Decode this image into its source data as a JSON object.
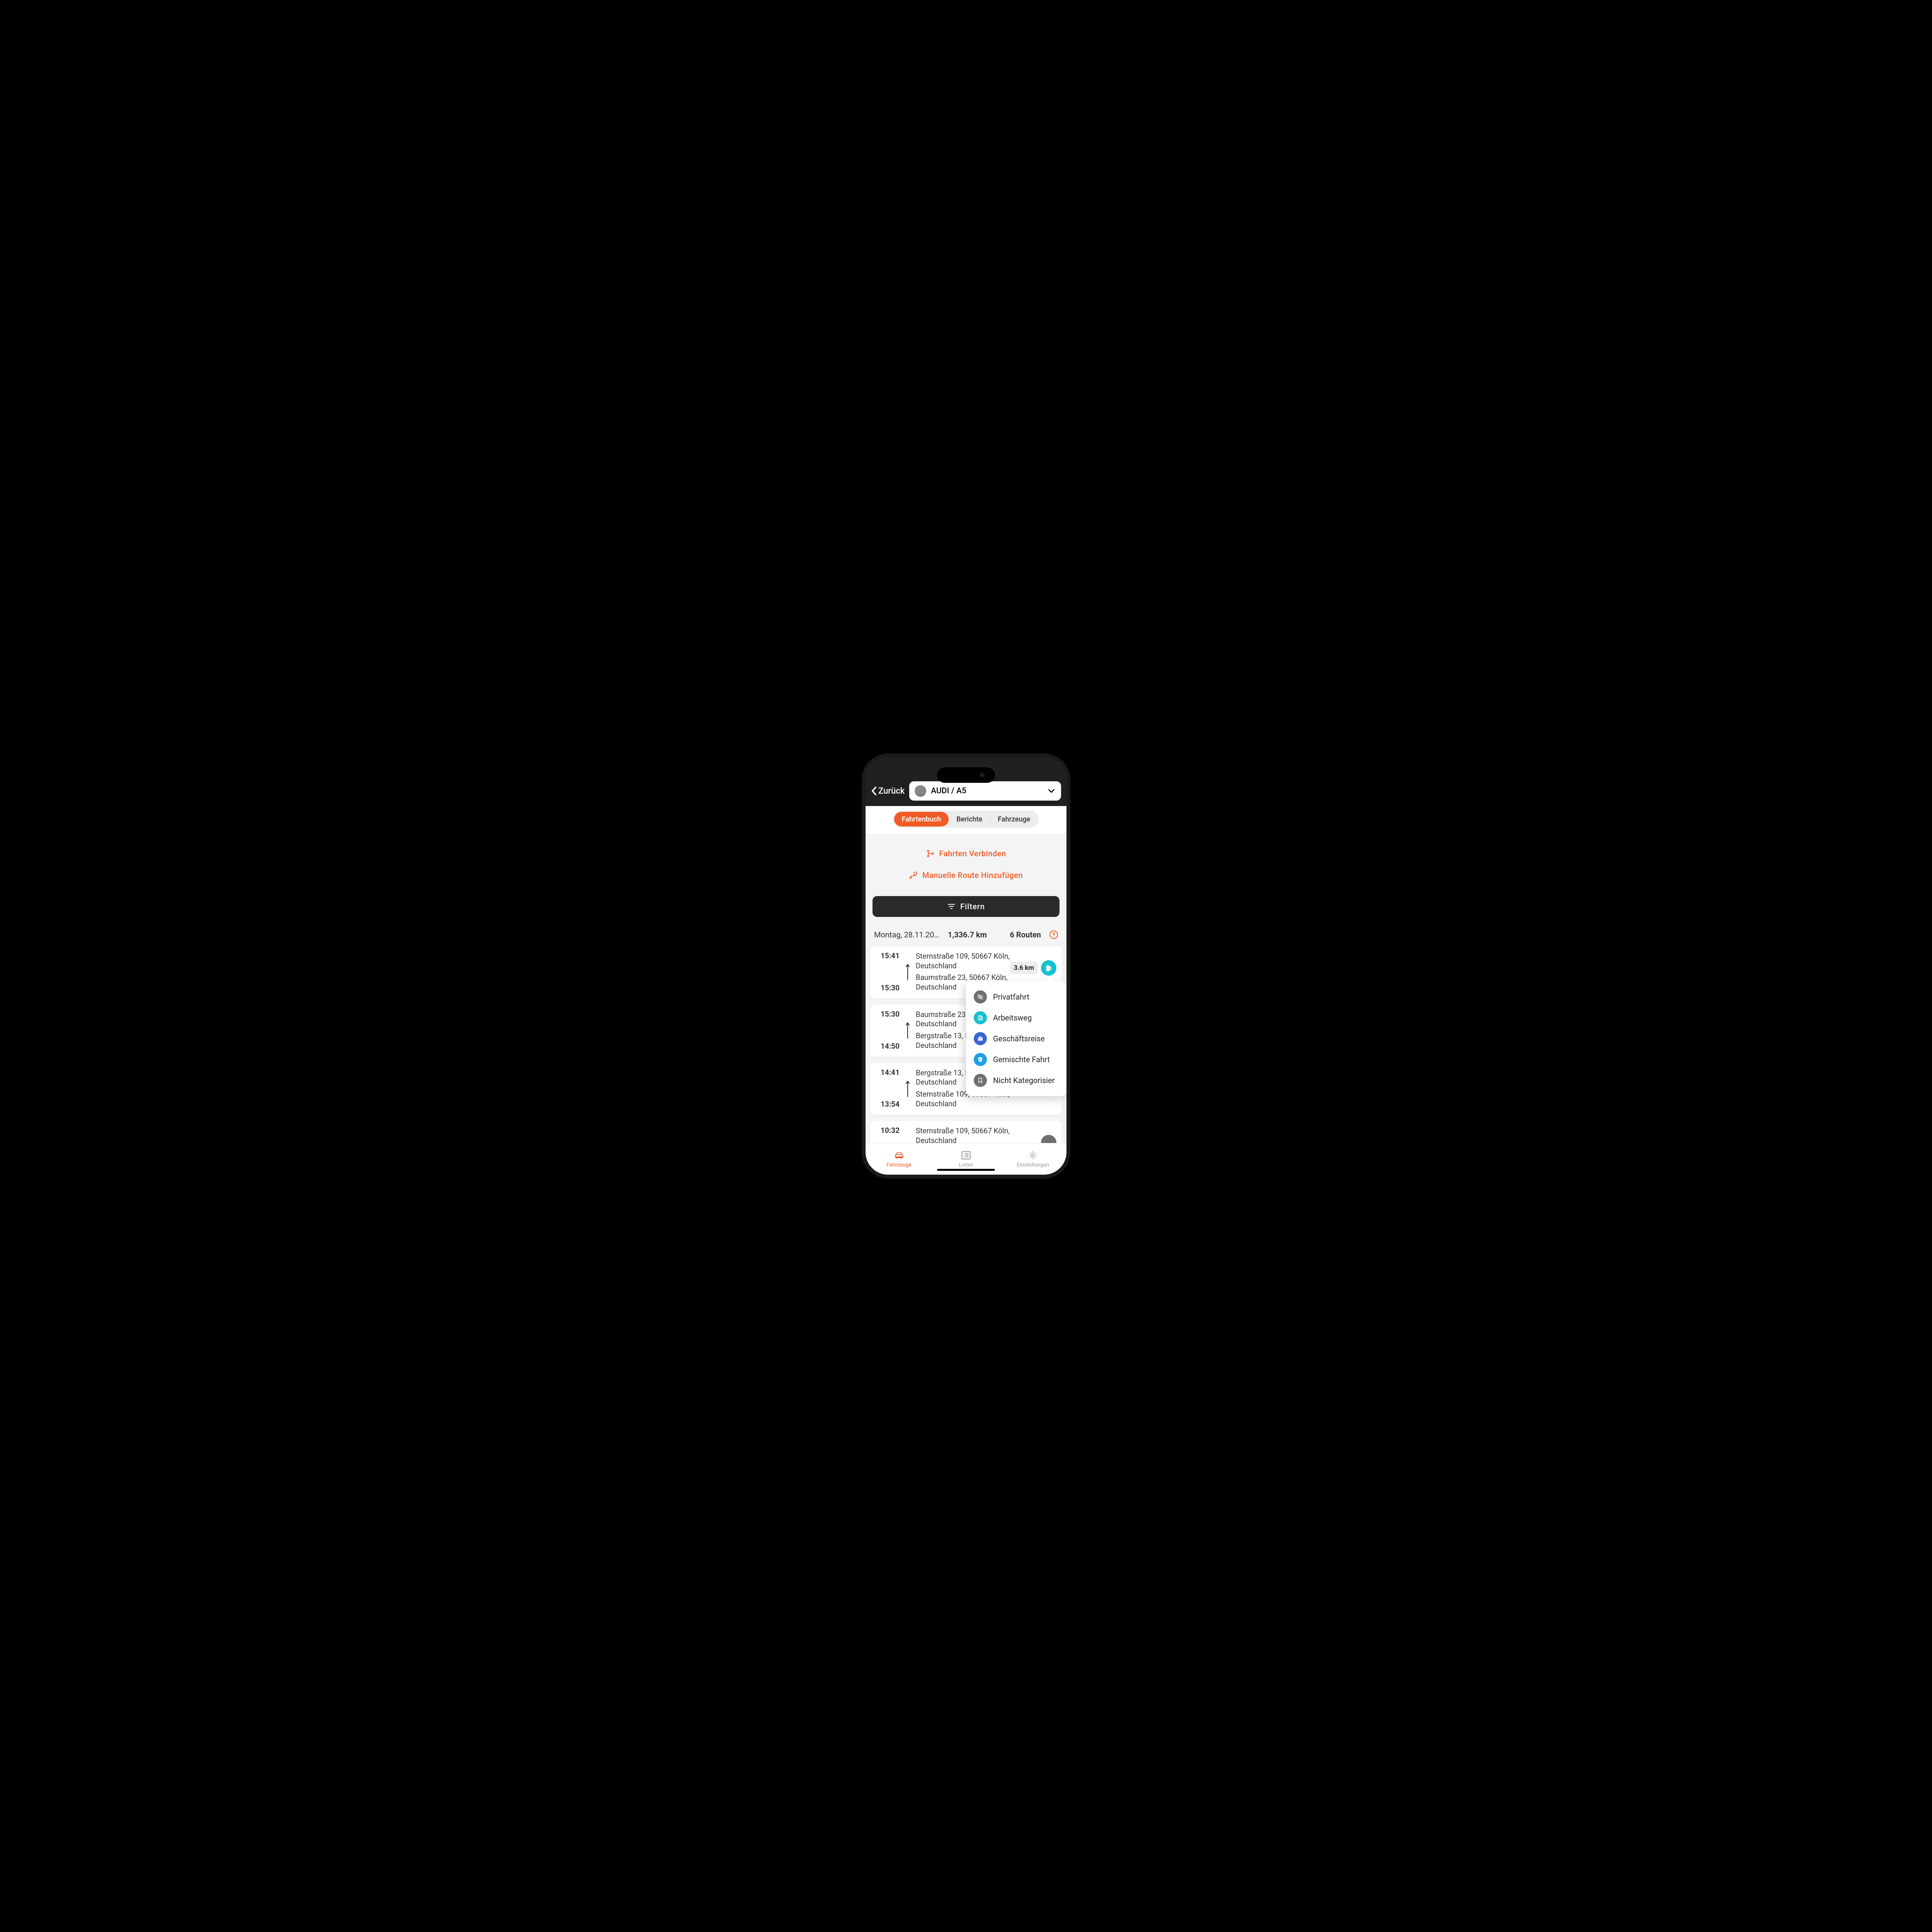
{
  "nav": {
    "back_label": "Zurück",
    "vehicle_label": "AUDI / A5"
  },
  "tabs_segmented": [
    {
      "label": "Fahrtenbuch",
      "active": true
    },
    {
      "label": "Berichte",
      "active": false
    },
    {
      "label": "Fahrzeuge",
      "active": false
    }
  ],
  "actions": {
    "connect_trips": "Fahrten Verbinden",
    "manual_route": "Manuelle Route Hinzufügen",
    "filter": "Filtern"
  },
  "summary": {
    "date": "Montag, 28.11.20…",
    "km": "1,336.7 km",
    "routes": "6 Routen"
  },
  "category_options": [
    {
      "key": "private",
      "label": "Privatfahrt",
      "color_class": "c-private"
    },
    {
      "key": "work",
      "label": "Arbeitsweg",
      "color_class": "c-work"
    },
    {
      "key": "business",
      "label": "Geschäftsreise",
      "color_class": "c-biz"
    },
    {
      "key": "mixed",
      "label": "Gemischte Fahrt",
      "color_class": "c-mixed"
    },
    {
      "key": "none",
      "label": "Nicht Kategorisier",
      "color_class": "c-none"
    }
  ],
  "routes": [
    {
      "end_time": "15:41",
      "end_addr": "Sternstraße 109, 50667 Köln, Deutschland",
      "start_time": "15:30",
      "start_addr": "Baumstraße 23, 50667 Köln, Deutschland",
      "distance": "3.6 km",
      "category": "work"
    },
    {
      "end_time": "15:30",
      "end_addr": "Baumstraße 23, 50667 Köln, Deutschland",
      "start_time": "14:50",
      "start_addr": "Bergstraße 13, 50667 Köln, Deutschland",
      "distance": "",
      "category": ""
    },
    {
      "end_time": "14:41",
      "end_addr": "Bergstraße 13, 50667 Köln, Deutschland",
      "start_time": "13:54",
      "start_addr": "Sternstraße 109, 50667 Köln, Deutschland",
      "distance": "",
      "category": ""
    },
    {
      "end_time": "10:32",
      "end_addr": "Sternstraße 109, 50667 Köln, Deutschland",
      "start_time": "",
      "start_addr": "",
      "distance": "",
      "category": "gray"
    }
  ],
  "bottom_tabs": [
    {
      "key": "vehicles",
      "label": "Fahrzeuge",
      "active": true
    },
    {
      "key": "lists",
      "label": "Listen",
      "active": false
    },
    {
      "key": "settings",
      "label": "Einstellungen",
      "active": false
    }
  ]
}
